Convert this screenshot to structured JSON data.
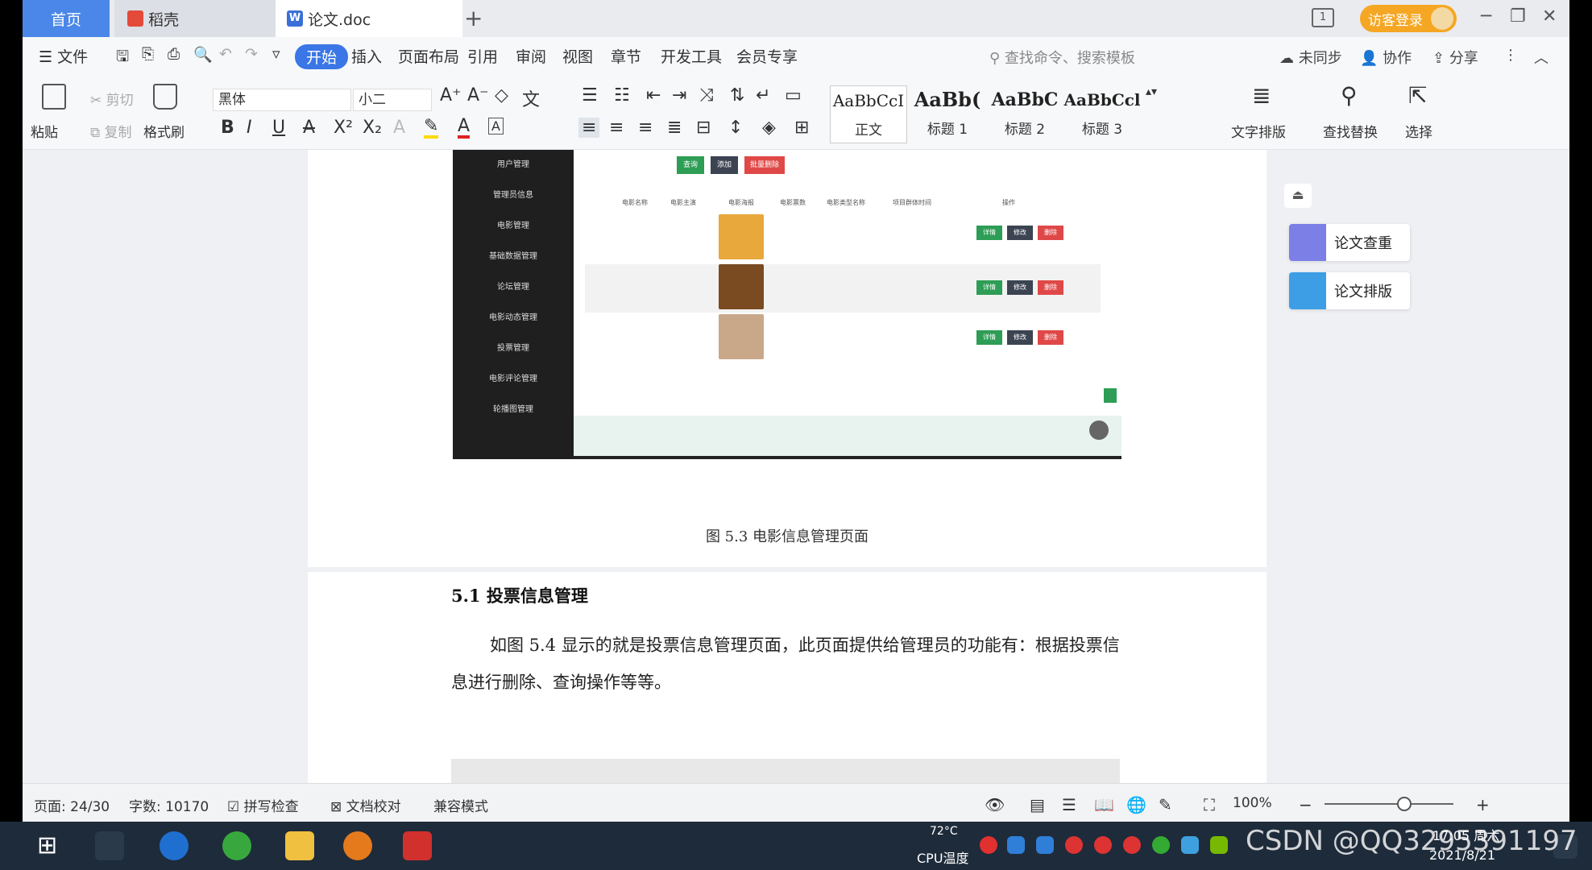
{
  "tabs": {
    "home": "首页",
    "daoke": "稻壳",
    "doc": "论文.doc",
    "add": "+",
    "page_count_icon": "1"
  },
  "visitor_login": "访客登录",
  "menu": {
    "file": "文件",
    "start": "开始",
    "insert": "插入",
    "layout": "页面布局",
    "reference": "引用",
    "review": "审阅",
    "view": "视图",
    "chapter": "章节",
    "devtools": "开发工具",
    "member": "会员专享",
    "search_placeholder": "查找命令、搜索模板",
    "unsynced": "未同步",
    "collab": "协作",
    "share": "分享"
  },
  "ribbon": {
    "paste": "粘贴",
    "cut": "剪切",
    "copy": "复制",
    "format_painter": "格式刷",
    "font": "黑体",
    "size": "小二",
    "styles": [
      {
        "sample": "AaBbCcI",
        "name": "正文"
      },
      {
        "sample": "AaBb(",
        "name": "标题 1"
      },
      {
        "sample": "AaBbC",
        "name": "标题 2"
      },
      {
        "sample": "AaBbCcl",
        "name": "标题 3"
      }
    ],
    "text_layout": "文字排版",
    "find_replace": "查找替换",
    "select": "选择"
  },
  "document": {
    "figure_caption": "图 5.3  电影信息管理页面",
    "section_heading": "5.1 投票信息管理",
    "paragraph": "如图 5.4 显示的就是投票信息管理页面，此页面提供给管理员的功能有：根据投票信息进行删除、查询操作等等。",
    "screenshot": {
      "sidebar": [
        "用户管理",
        "管理员信息",
        "电影管理",
        "基础数据管理",
        "论坛管理",
        "电影动态管理",
        "投票管理",
        "电影评论管理",
        "轮播图管理"
      ],
      "buttons": [
        "查询",
        "添加",
        "批量删除"
      ],
      "headers": [
        "电影名称",
        "电影主演",
        "电影海报",
        "电影票数",
        "电影类型名称",
        "项目群体时间",
        "操作"
      ],
      "actions": [
        "详情",
        "修改",
        "删除"
      ]
    }
  },
  "side_panel": {
    "check": "论文查重",
    "format": "论文排版"
  },
  "status": {
    "page": "页面: 24/30",
    "words": "字数: 10170",
    "spell": "拼写检查",
    "proof": "文档校对",
    "compat": "兼容模式",
    "zoom": "100%"
  },
  "taskbar": {
    "temp": "72°C",
    "cpu": "CPU温度",
    "time": "17:05 周六",
    "date": "2021/8/21",
    "watermark": "CSDN @QQ3295391197"
  },
  "colors": {
    "accent": "#3a76e5",
    "home_tab": "#4a87e8",
    "visitor": "#f5a623",
    "taskbar": "#1e2b3a"
  }
}
